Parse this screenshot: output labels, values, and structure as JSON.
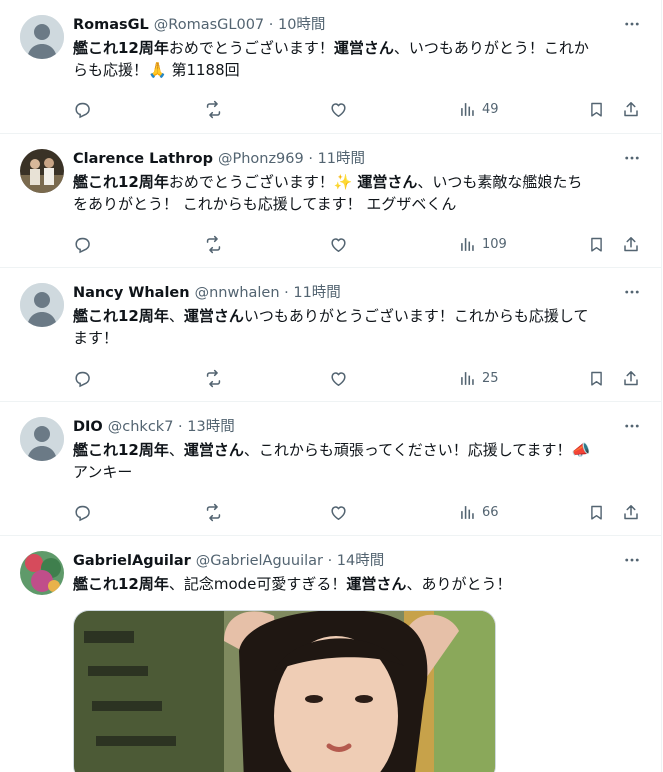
{
  "tweets": [
    {
      "name": "RomasGL",
      "meta": "@RomasGL007 · 10時間",
      "avatar": "default-avatar",
      "lines": [
        [
          {
            "t": "艦これ12周年",
            "b": true
          },
          {
            "t": "おめでとうございます！"
          },
          {
            "t": "運営さん",
            "b": true
          },
          {
            "t": "、いつもありがとう！これか"
          }
        ],
        [
          {
            "t": "らも応援！🙏 第1188回"
          }
        ]
      ],
      "views": "49"
    },
    {
      "name": "Clarence Lathrop",
      "meta": "@Phonz969 · 11時間",
      "avatar": "photo-avatar",
      "lines": [
        [
          {
            "t": "艦これ12周年",
            "b": true
          },
          {
            "t": "おめでとうございます！✨ "
          },
          {
            "t": "運営さん",
            "b": true
          },
          {
            "t": "、いつも素敵な艦娘たち"
          }
        ],
        [
          {
            "t": "をありがとう！ これからも応援してます！ エグザベくん"
          }
        ]
      ],
      "views": "109"
    },
    {
      "name": "Nancy Whalen",
      "meta": "@nnwhalen · 11時間",
      "avatar": "default-avatar",
      "lines": [
        [
          {
            "t": "艦これ12周年",
            "b": true
          },
          {
            "t": "、"
          },
          {
            "t": "運営さん",
            "b": true
          },
          {
            "t": "いつもありがとうございます！これからも応援して"
          }
        ],
        [
          {
            "t": "ます！"
          }
        ]
      ],
      "views": "25"
    },
    {
      "name": "DIO",
      "meta": "@chkck7 · 13時間",
      "avatar": "default-avatar",
      "lines": [
        [
          {
            "t": "艦これ12周年",
            "b": true
          },
          {
            "t": "、"
          },
          {
            "t": "運営さん",
            "b": true
          },
          {
            "t": "、これからも頑張ってください！応援してます！📣"
          }
        ],
        [
          {
            "t": "アンキー"
          }
        ]
      ],
      "views": "66"
    },
    {
      "name": "GabrielAguilar",
      "meta": "@GabrielAguuilar · 14時間",
      "avatar": "photo-avatar",
      "lines": [
        [
          {
            "t": "艦これ12周年",
            "b": true
          },
          {
            "t": "、記念mode可愛すぎる！"
          },
          {
            "t": "運営さん",
            "b": true
          },
          {
            "t": "、ありがとう！"
          }
        ]
      ],
      "views": null,
      "media": "photo"
    }
  ],
  "colors": {
    "text": "#0f1419",
    "secondary": "#536471",
    "border": "#eff3f4",
    "avatar_bg": "#cfd9de"
  },
  "icons": {
    "reply": "reply-icon",
    "retweet": "retweet-icon",
    "like": "like-icon",
    "views": "views-icon",
    "bookmark": "bookmark-icon",
    "share": "share-icon",
    "more": "more-icon"
  }
}
